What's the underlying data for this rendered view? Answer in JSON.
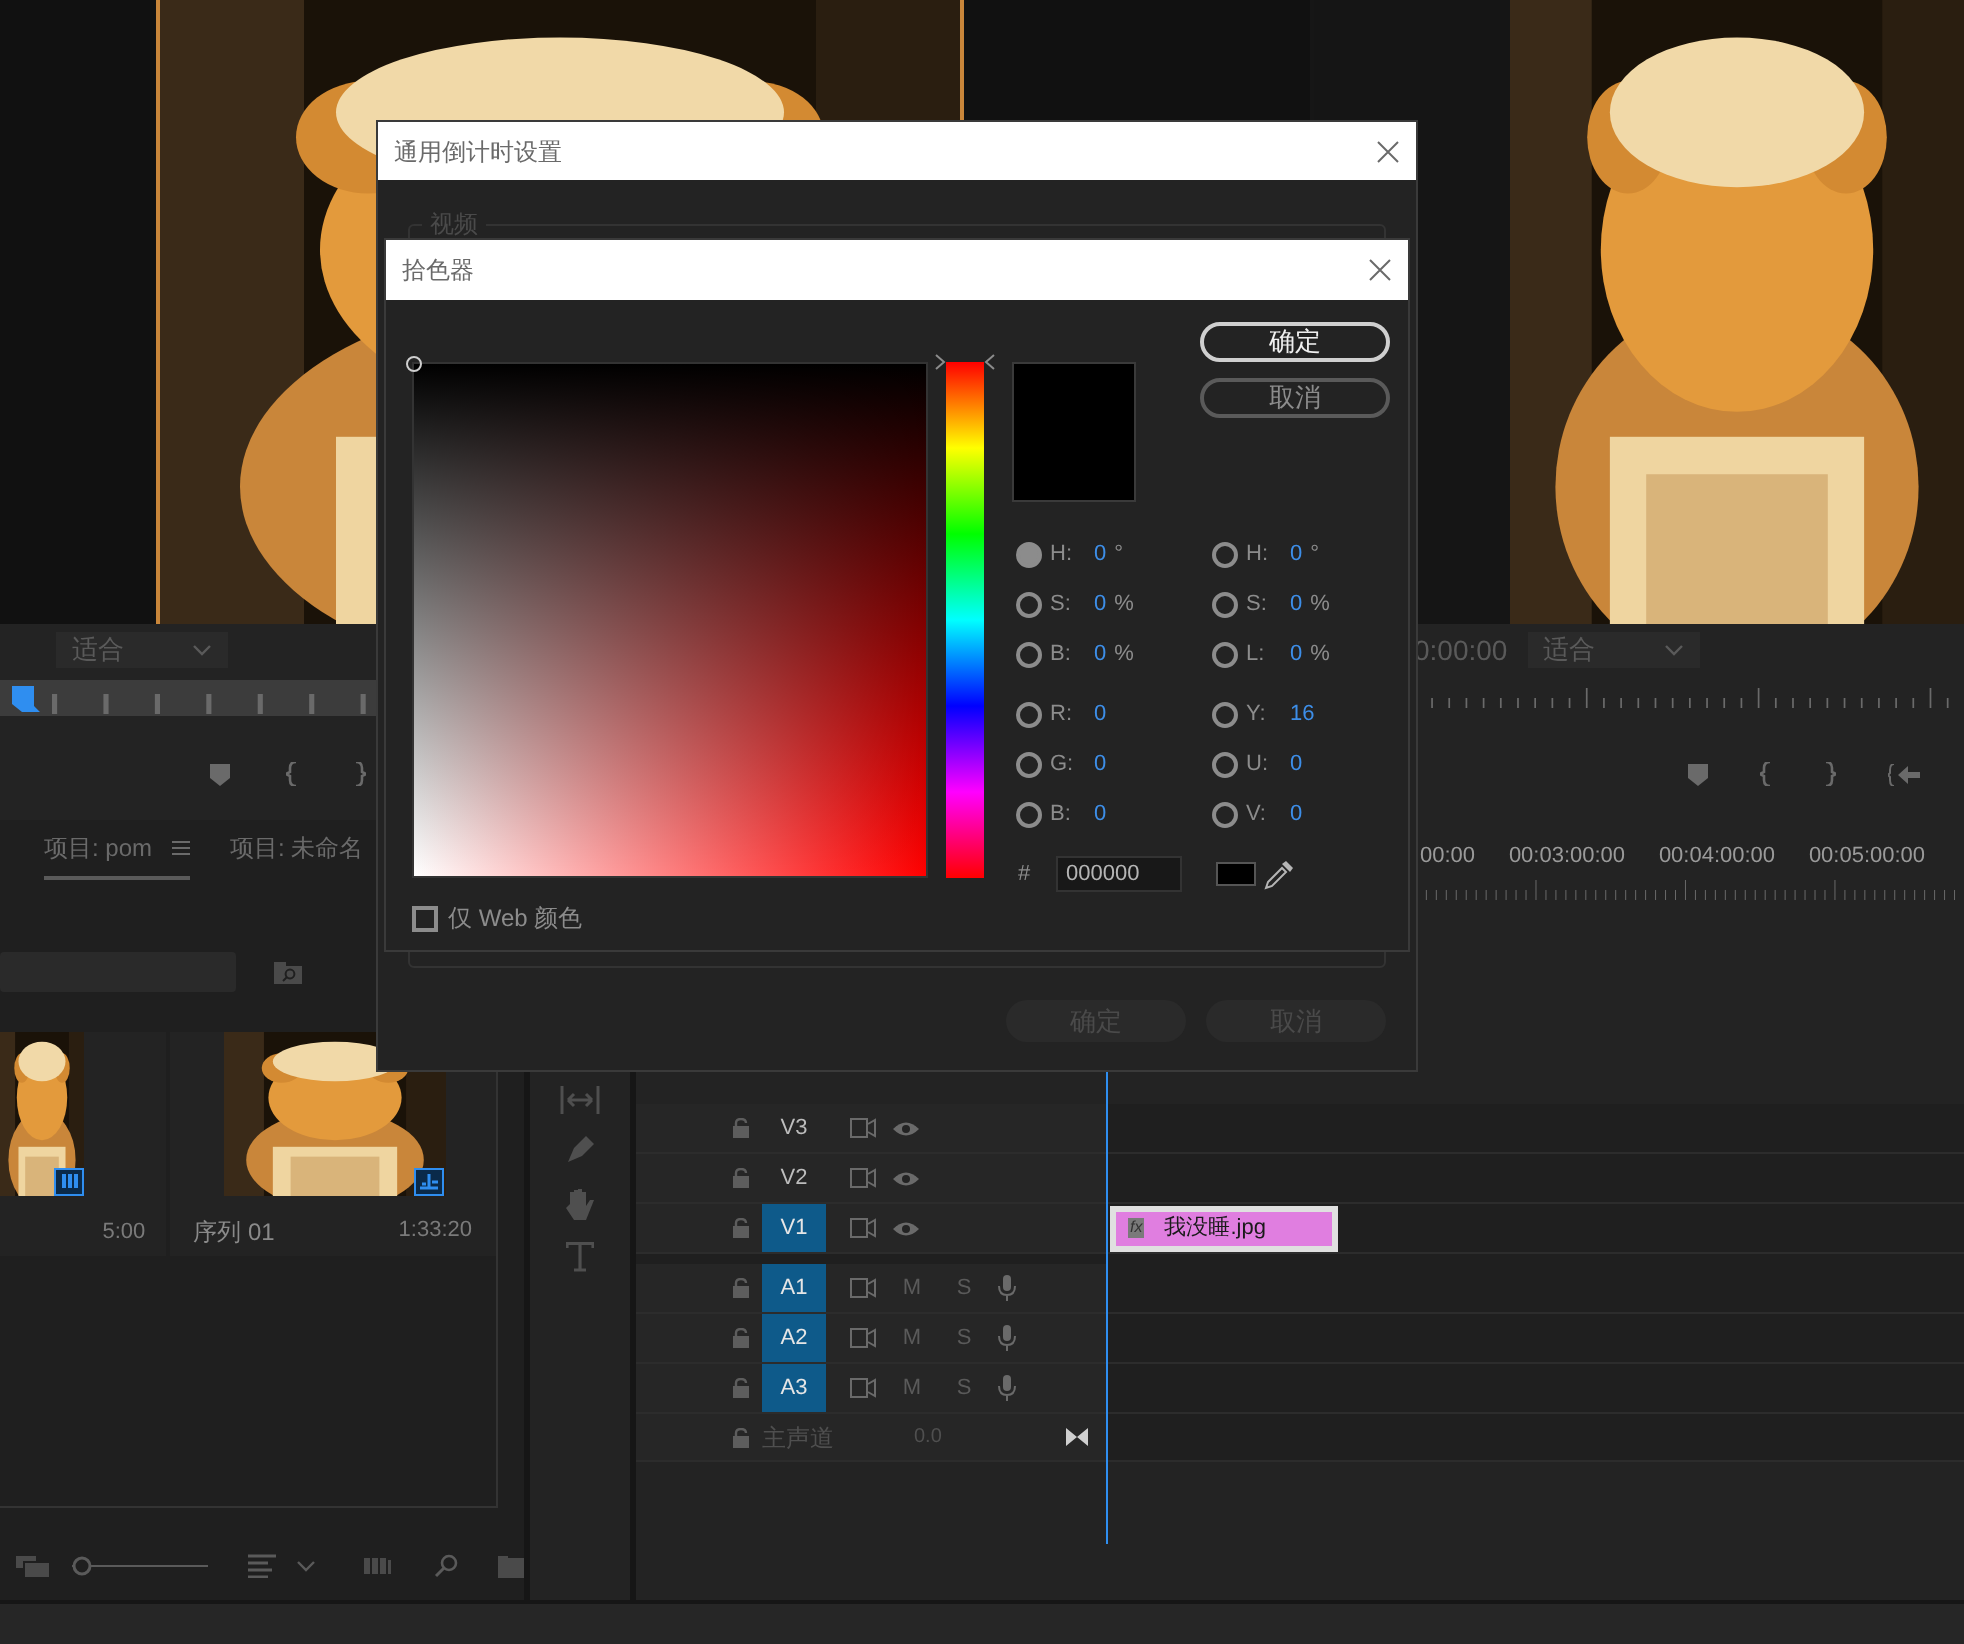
{
  "source_monitor": {
    "zoom": "适合"
  },
  "program_monitor": {
    "timecode": "0:00:00",
    "zoom": "适合"
  },
  "project_panel": {
    "tabs": [
      {
        "label": "项目: pom",
        "selected": true
      },
      {
        "label": "项目: 未命名",
        "selected": false
      }
    ],
    "zoom_slider": {
      "level": 0
    },
    "items": [
      {
        "duration": "5:00",
        "kind": "clip"
      },
      {
        "name": "序列 01",
        "duration": "1:33:20",
        "kind": "sequence"
      }
    ]
  },
  "timeline": {
    "ruler": [
      "00:00",
      "00:03:00:00",
      "00:04:00:00",
      "00:05:00:00"
    ],
    "tracks": [
      {
        "kind": "video",
        "label": "V3",
        "selected": false
      },
      {
        "kind": "video",
        "label": "V2",
        "selected": false
      },
      {
        "kind": "video",
        "label": "V1",
        "selected": true
      },
      {
        "kind": "audio",
        "label": "A1",
        "selected": true,
        "mute": "M",
        "solo": "S"
      },
      {
        "kind": "audio",
        "label": "A2",
        "selected": true,
        "mute": "M",
        "solo": "S"
      },
      {
        "kind": "audio",
        "label": "A3",
        "selected": true,
        "mute": "M",
        "solo": "S"
      }
    ],
    "master": {
      "label": "主声道",
      "value": "0.0"
    },
    "clip": {
      "fx": "fx",
      "name": "我没睡.jpg",
      "color": "#e07ee0"
    }
  },
  "countdown_dialog": {
    "title": "通用倒计时设置",
    "group_label": "视频",
    "buttons": [
      {
        "label": "确定",
        "disabled": true
      },
      {
        "label": "取消",
        "disabled": true
      }
    ]
  },
  "color_picker": {
    "title": "拾色器",
    "buttons": [
      {
        "label": "确定",
        "default": true
      },
      {
        "label": "取消",
        "default": false
      }
    ],
    "fields_left": [
      {
        "label": "H:",
        "value": "0",
        "unit": "°",
        "selected": true
      },
      {
        "label": "S:",
        "value": "0",
        "unit": "%",
        "selected": false
      },
      {
        "label": "B:",
        "value": "0",
        "unit": "%",
        "selected": false
      },
      {
        "label": "R:",
        "value": "0",
        "selected": false
      },
      {
        "label": "G:",
        "value": "0",
        "selected": false
      },
      {
        "label": "B:",
        "value": "0",
        "selected": false
      }
    ],
    "fields_right": [
      {
        "label": "H:",
        "value": "0",
        "unit": "°",
        "selected": false
      },
      {
        "label": "S:",
        "value": "0",
        "unit": "%",
        "selected": false
      },
      {
        "label": "L:",
        "value": "0",
        "unit": "%",
        "selected": false
      },
      {
        "label": "Y:",
        "value": "16",
        "selected": false
      },
      {
        "label": "U:",
        "value": "0",
        "selected": false
      },
      {
        "label": "V:",
        "value": "0",
        "selected": false
      }
    ],
    "hue_slider": {
      "level": 0
    },
    "hex_label": "#",
    "hex": "000000",
    "web_only": {
      "label": "仅 Web 颜色",
      "checked": false
    }
  }
}
